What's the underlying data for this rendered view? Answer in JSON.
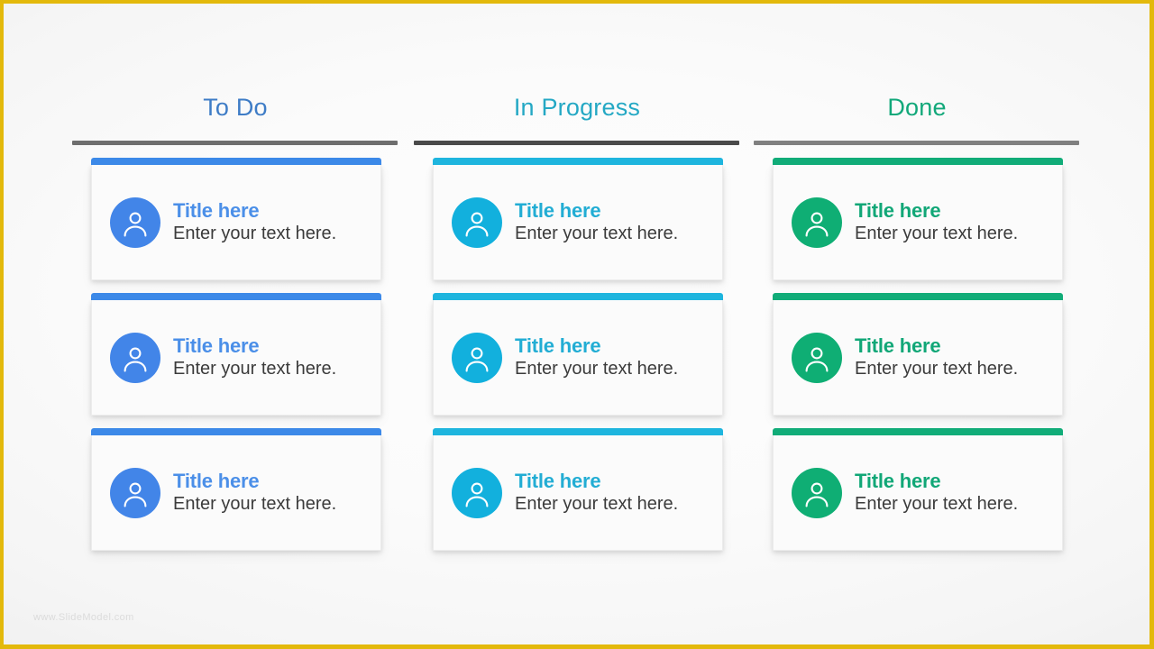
{
  "slide": {
    "frame_color": "#E3B90B",
    "background": "light-gray-radial-gradient",
    "watermark": "www.SlideModel.com"
  },
  "board": {
    "columns": [
      {
        "id": "todo",
        "header": "To Do",
        "header_color": "#3E7CC6",
        "rule_color": "#6E6E6E",
        "accent_color": "#3C89E8",
        "avatar_color": "#4285E8",
        "title_color": "#4B8FE8",
        "avatar_icon": "person-icon",
        "cards": [
          {
            "title": "Title here",
            "description": "Enter your text here."
          },
          {
            "title": "Title here",
            "description": "Enter your text here."
          },
          {
            "title": "Title here",
            "description": "Enter your text here."
          }
        ]
      },
      {
        "id": "in-progress",
        "header": "In Progress",
        "header_color": "#24A8C4",
        "rule_color": "#4A4A4A",
        "accent_color": "#1EB5DE",
        "avatar_color": "#12B0DD",
        "title_color": "#22ADD4",
        "avatar_icon": "person-icon",
        "cards": [
          {
            "title": "Title here",
            "description": "Enter your text here."
          },
          {
            "title": "Title here",
            "description": "Enter your text here."
          },
          {
            "title": "Title here",
            "description": "Enter your text here."
          }
        ]
      },
      {
        "id": "done",
        "header": "Done",
        "header_color": "#12A87A",
        "rule_color": "#808080",
        "accent_color": "#11AC78",
        "avatar_color": "#0FAE74",
        "title_color": "#11A777",
        "avatar_icon": "person-icon",
        "cards": [
          {
            "title": "Title here",
            "description": "Enter your text here."
          },
          {
            "title": "Title here",
            "description": "Enter your text here."
          },
          {
            "title": "Title here",
            "description": "Enter your text here."
          }
        ]
      }
    ]
  }
}
